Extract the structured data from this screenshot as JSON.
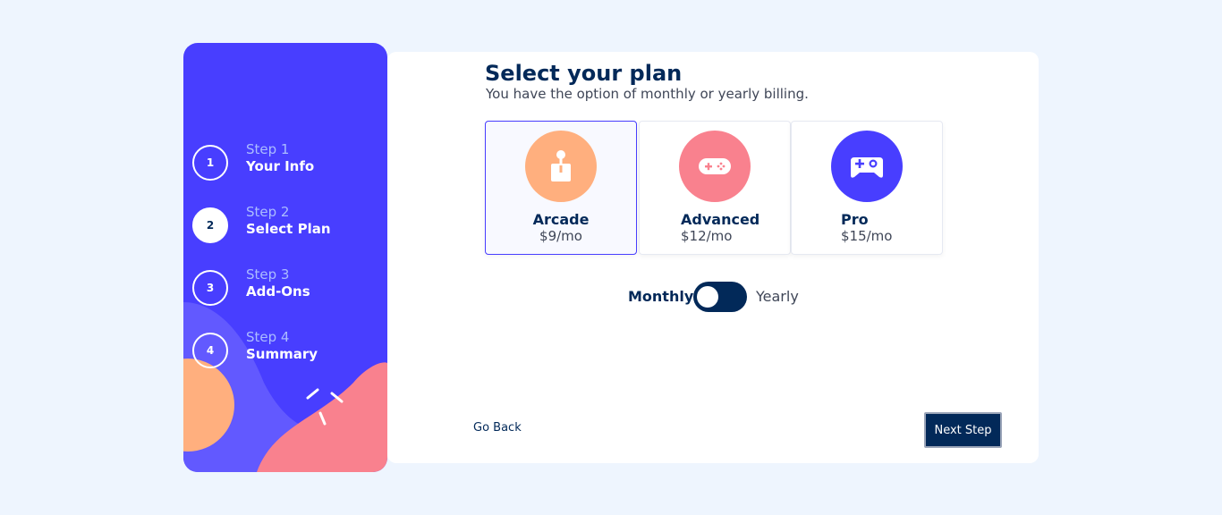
{
  "sidebar": {
    "steps": [
      {
        "number": "1",
        "label": "Step 1",
        "name": "Your Info"
      },
      {
        "number": "2",
        "label": "Step 2",
        "name": "Select Plan"
      },
      {
        "number": "3",
        "label": "Step 3",
        "name": "Add-Ons"
      },
      {
        "number": "4",
        "label": "Step 4",
        "name": "Summary"
      }
    ]
  },
  "main": {
    "title": "Select your plan",
    "subtitle": "You have the option of monthly or yearly billing.",
    "plans": [
      {
        "name": "Arcade",
        "price": "$9/mo",
        "icon": "arcade-joystick-icon",
        "color": "#ffaf7e"
      },
      {
        "name": "Advanced",
        "price": "$12/mo",
        "icon": "gamepad-icon",
        "color": "#f9818e"
      },
      {
        "name": "Pro",
        "price": "$15/mo",
        "icon": "controller-icon",
        "color": "#483eff"
      }
    ],
    "selected_plan": "Arcade",
    "billing": {
      "monthly_label": "Monthly",
      "yearly_label": "Yearly",
      "selected": "Monthly"
    }
  },
  "footer": {
    "back_label": "Go Back",
    "next_label": "Next Step"
  },
  "colors": {
    "sidebar": "#483eff",
    "navy": "#022959",
    "page_bg": "#eef5fe"
  }
}
